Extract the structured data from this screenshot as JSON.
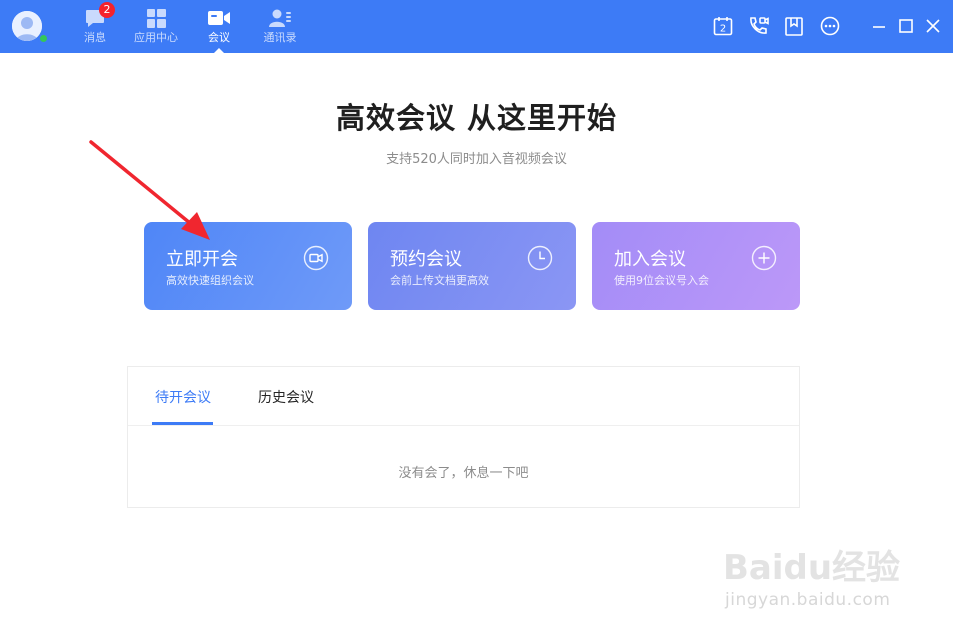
{
  "topbar": {
    "nav": [
      {
        "label": "消息",
        "icon": "message-icon",
        "badge": "2"
      },
      {
        "label": "应用中心",
        "icon": "apps-icon"
      },
      {
        "label": "会议",
        "icon": "video-icon",
        "active": true
      },
      {
        "label": "通讯录",
        "icon": "contacts-icon"
      }
    ],
    "tools": [
      "calendar-icon",
      "phone-video-icon",
      "bookmark-icon",
      "more-icon",
      "minimize-icon",
      "maximize-icon",
      "close-icon"
    ],
    "calendar_day": "2",
    "accent": "#3d7bf6"
  },
  "hero": {
    "title": "高效会议 从这里开始",
    "subtitle": "支持520人同时加入音视频会议"
  },
  "cards": [
    {
      "title": "立即开会",
      "subtitle": "高效快速组织会议",
      "icon": "video-camera-icon"
    },
    {
      "title": "预约会议",
      "subtitle": "会前上传文档更高效",
      "icon": "clock-icon"
    },
    {
      "title": "加入会议",
      "subtitle": "使用9位会议号入会",
      "icon": "plus-circle-icon"
    }
  ],
  "meetings": {
    "tabs": [
      "待开会议",
      "历史会议"
    ],
    "active_tab": 0,
    "empty_text": "没有会了，休息一下吧"
  },
  "watermark": {
    "brand": "Baidu经验",
    "url": "jingyan.baidu.com"
  }
}
